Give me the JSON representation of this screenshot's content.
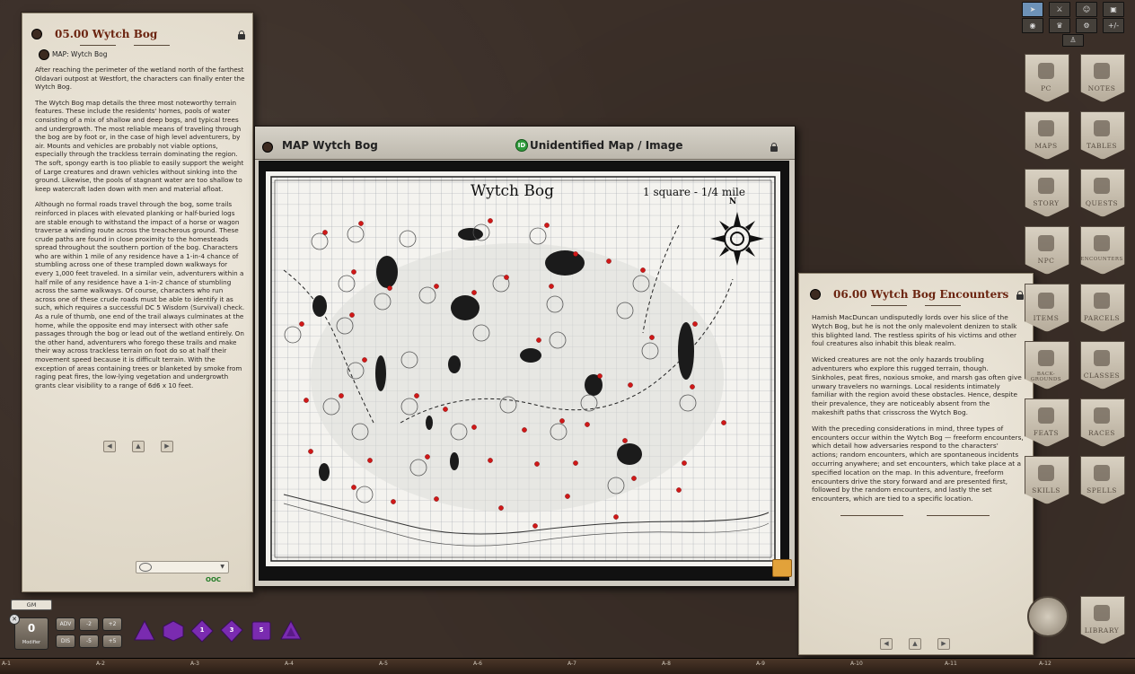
{
  "story": {
    "title": "05.00 Wytch Bog",
    "link_label": "MAP: Wytch Bog",
    "paragraphs": [
      "After reaching the perimeter of the wetland north of the farthest Oldavari outpost at Westfort, the characters can finally enter the Wytch Bog.",
      "The Wytch Bog map details the three most noteworthy terrain features. These include the residents' homes, pools of water consisting of a mix of shallow and deep bogs, and typical trees and undergrowth. The most reliable means of traveling through the bog are by foot or, in the case of high level adventurers, by air. Mounts and vehicles are probably not viable options, especially through the trackless terrain dominating the region. The soft, spongy earth is too pliable to easily support the weight of Large creatures and drawn vehicles without sinking into the ground. Likewise, the pools of stagnant water are too shallow to keep watercraft laden down with men and material afloat.",
      "Although no formal roads travel through the bog, some trails reinforced in places with elevated planking or half-buried logs are stable enough to withstand the impact of a horse or wagon traverse a winding route across the treacherous ground. These crude paths are found in close proximity to the homesteads spread throughout the southern portion of the bog. Characters who are within 1 mile of any residence have a 1-in-4 chance of stumbling across one of these trampled down walkways for every 1,000 feet traveled. In a similar vein, adventurers within a half mile of any residence have a 1-in-2 chance of stumbling across the same walkways. Of course, characters who run across one of these crude roads must be able to identify it as such, which requires a successful DC 5 Wisdom (Survival) check. As a rule of thumb, one end of the trail always culminates at the home, while the opposite end may intersect with other safe passages through the bog or lead out of the wetland entirely. On the other hand, adventurers who forego these trails and make their way across trackless terrain on foot do so at half their movement speed because it is difficult terrain. With the exception of areas containing trees or blanketed by smoke from raging peat fires, the low-lying vegetation and undergrowth grants clear visibility to a range of 6d6 x 10 feet."
    ],
    "chat_status": "OOC"
  },
  "map": {
    "window_title": "MAP Wytch Bog",
    "id_title": "Unidentified Map / Image",
    "id_badge": "ID",
    "sheet_title": "Wytch Bog",
    "scale": "1 square - 1/4 mile",
    "compass_north": "N"
  },
  "encounters": {
    "title": "06.00 Wytch Bog Encounters",
    "paragraphs": [
      "Hamish MacDuncan undisputedly lords over his slice of the Wytch Bog, but he is not the only malevolent denizen to stalk this blighted land. The restless spirits of his victims and other foul creatures also inhabit this bleak realm.",
      "Wicked creatures are not the only hazards troubling adventurers who explore this rugged terrain, though. Sinkholes, peat fires, noxious smoke, and marsh gas often give unwary travelers no warnings. Local residents intimately familiar with the region avoid these obstacles. Hence, despite their prevalence, they are noticeably absent from the makeshift paths that crisscross the Wytch Bog.",
      "With the preceding considerations in mind, three types of encounters occur within the Wytch Bog — freeform encounters, which detail how adversaries respond to the characters' actions; random encounters, which are spontaneous incidents occurring anywhere; and set encounters, which take place at a specified location on the map. In this adventure, freeform encounters drive the story forward and are presented first, followed by the random encounters, and lastly the set encounters, which are tied to a specific location."
    ]
  },
  "sidebar": {
    "buttons": [
      "PC",
      "NOTES",
      "MAPS",
      "TABLES",
      "STORY",
      "QUESTS",
      "NPC",
      "ENCOUNTERS",
      "ITEMS",
      "PARCELS",
      "BACK-GROUNDS",
      "CLASSES",
      "FEATS",
      "RACES",
      "SKILLS",
      "SPELLS"
    ],
    "library_label": "LIBRARY"
  },
  "topbar": {
    "icons": [
      "pointer-icon",
      "crossed-swords-icon",
      "people-icon",
      "toolbox-icon",
      "eye-icon",
      "crown-icon",
      "gear-icon",
      "plus-minus-icon",
      "figure-icon"
    ],
    "plus_minus_label": "+/-"
  },
  "bottom": {
    "gm_label": "GM",
    "modifier_value": "0",
    "modifier_caption": "Modifier",
    "mod_buttons": [
      "ADV",
      "-2",
      "+2",
      "DIS",
      "-5",
      "+5"
    ],
    "dice": [
      "d4",
      "d6",
      "d8",
      "d10",
      "d12",
      "d20"
    ],
    "dice_values": [
      "",
      "",
      "1",
      "3",
      "5",
      ""
    ],
    "hotbar_labels": [
      "A-1",
      "A-2",
      "A-3",
      "A-4",
      "A-5",
      "A-6",
      "A-7",
      "A-8",
      "A-9",
      "A-10",
      "A-11",
      "A-12"
    ]
  },
  "colors": {
    "accent_title": "#6b2410",
    "dice_purple": "#7a2bb0",
    "map_pin": "#d01818",
    "id_green": "#2e9a3a"
  }
}
